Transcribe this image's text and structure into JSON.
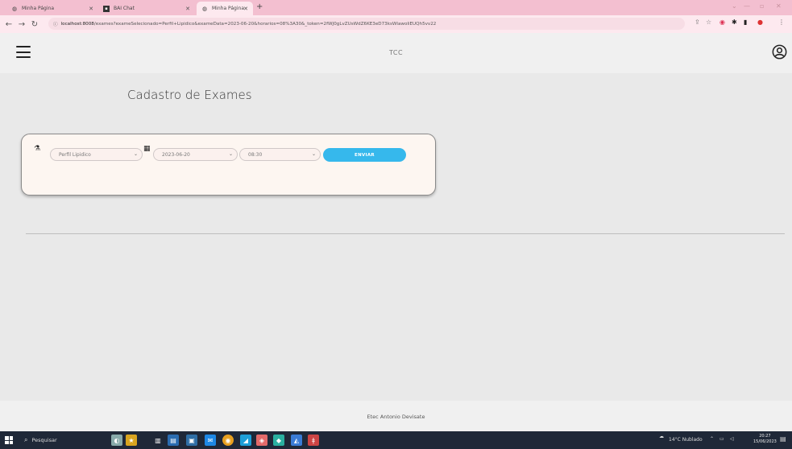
{
  "browser": {
    "tabs": [
      {
        "title": "Minha Página",
        "icon": "globe-icon"
      },
      {
        "title": "BAI Chat",
        "icon": "chat-icon"
      },
      {
        "title": "Minha Página",
        "icon": "globe-icon"
      }
    ],
    "new_tab": "+",
    "url_host": "localhost:8008",
    "url_path": "/exames?exameSelecionado=Perfil+Lipidico&exameData=2023-06-20&horarios=08%3A30&_token=2fWJ0gLvZUsWdZ6KE3eD73ksWlawoliEUQh5vv22"
  },
  "app": {
    "title": "TCC",
    "page_title": "Cadastro de Exames",
    "form": {
      "exam_value": "Perfil Lipidico",
      "date_value": "2023-06-20",
      "time_value": "08:30",
      "submit_label": "ENVIAR"
    },
    "footer": "Etec Antonio Devisate"
  },
  "taskbar": {
    "search_placeholder": "Pesquisar",
    "weather": "14°C Nublado",
    "time": "20:27",
    "date": "15/06/2023"
  },
  "colors": {
    "accent": "#36b8ec",
    "tabbar": "#f3bfd0",
    "card_bg": "#fdf6f1"
  }
}
